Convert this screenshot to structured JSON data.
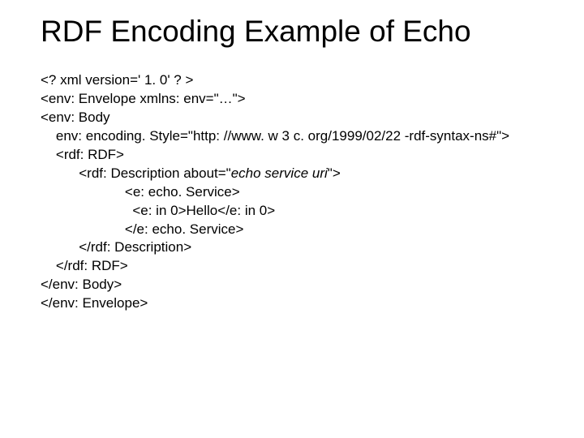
{
  "title": "RDF Encoding Example of Echo",
  "code": {
    "l1": "<? xml version=' 1. 0' ? >",
    "l2": "<env: Envelope xmlns: env=\"…\">",
    "l3": "<env: Body",
    "l4": "    env: encoding. Style=\"http: //www. w 3 c. org/1999/02/22 -rdf-syntax-ns#\">",
    "l5": "    <rdf: RDF>",
    "l6_a": "          <rdf: Description about=\"",
    "l6_b": "echo service uri",
    "l6_c": "\">",
    "l7": "                      <e: echo. Service>",
    "l8": "                        <e: in 0>Hello</e: in 0>",
    "l9": "                      </e: echo. Service>",
    "l10": "          </rdf: Description>",
    "l11": "    </rdf: RDF>",
    "l12": "</env: Body>",
    "l13": "</env: Envelope>"
  }
}
